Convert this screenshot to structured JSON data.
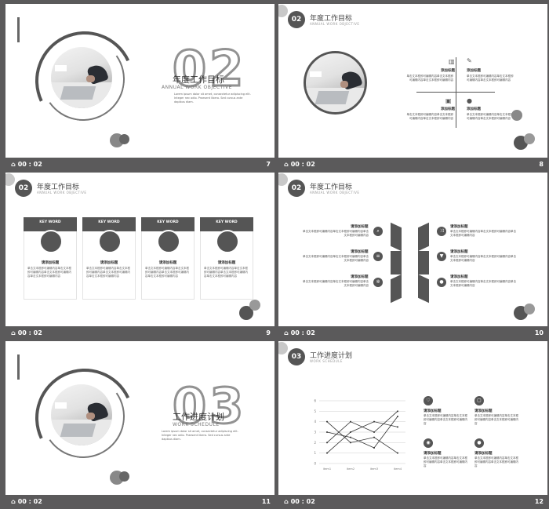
{
  "slides": [
    {
      "footer_time": "00 : 02",
      "page": "7",
      "section_num": "02",
      "title_cn": "年度工作目标",
      "title_en": "ANNUAL WORK OBJECTIVE",
      "desc": "Lorem ipsum dolor sit amet, consectetur adipiscing elit. Integer nec odio. Praesent libero. Sed cursus ante dapibus diam."
    },
    {
      "footer_time": "00 : 02",
      "page": "8",
      "section_num": "02",
      "title_cn": "年度工作目标",
      "title_en": "ANNUAL WORK OBJECTIVE",
      "items": [
        {
          "label": "添加标题",
          "text": "单击文本框即可编辑内容单击文本框即可编辑内容单击文本框即可编辑内容"
        },
        {
          "label": "添加标题",
          "text": "单击文本框即可编辑内容单击文本框即可编辑内容单击文本框即可编辑内容"
        },
        {
          "label": "添加标题",
          "text": "单击文本框即可编辑内容单击文本框即可编辑内容单击文本框即可编辑内容"
        },
        {
          "label": "添加标题",
          "text": "单击文本框即可编辑内容单击文本框即可编辑内容单击文本框即可编辑内容"
        }
      ]
    },
    {
      "footer_time": "00 : 02",
      "page": "9",
      "section_num": "02",
      "title_cn": "年度工作目标",
      "title_en": "ANNUAL WORK OBJECTIVE",
      "cards": [
        {
          "kw": "KEY WORD",
          "label": "请添加标题",
          "text": "单击文本框即可编辑内容单击文本框即可编辑内容单击文本框即可编辑内容单击文本框即可编辑内容"
        },
        {
          "kw": "KEY WORD",
          "label": "请添加标题",
          "text": "单击文本框即可编辑内容单击文本框即可编辑内容单击文本框即可编辑内容单击文本框即可编辑内容"
        },
        {
          "kw": "KEY WORD",
          "label": "请添加标题",
          "text": "单击文本框即可编辑内容单击文本框即可编辑内容单击文本框即可编辑内容单击文本框即可编辑内容"
        },
        {
          "kw": "KEY WORD",
          "label": "请添加标题",
          "text": "单击文本框即可编辑内容单击文本框即可编辑内容单击文本框即可编辑内容单击文本框即可编辑内容"
        }
      ]
    },
    {
      "footer_time": "00 : 02",
      "page": "10",
      "section_num": "02",
      "title_cn": "年度工作目标",
      "title_en": "ANNUAL WORK OBJECTIVE",
      "left_items": [
        {
          "label": "请添加标题",
          "text": "单击文本框即可编辑内容单击文本框即可编辑内容单击文本框即可编辑内容"
        },
        {
          "label": "请添加标题",
          "text": "单击文本框即可编辑内容单击文本框即可编辑内容单击文本框即可编辑内容"
        },
        {
          "label": "请添加标题",
          "text": "单击文本框即可编辑内容单击文本框即可编辑内容单击文本框即可编辑内容"
        }
      ],
      "right_items": [
        {
          "label": "请添加标题",
          "text": "单击文本框即可编辑内容单击文本框即可编辑内容单击文本框即可编辑内容"
        },
        {
          "label": "请添加标题",
          "text": "单击文本框即可编辑内容单击文本框即可编辑内容单击文本框即可编辑内容"
        },
        {
          "label": "请添加标题",
          "text": "单击文本框即可编辑内容单击文本框即可编辑内容单击文本框即可编辑内容"
        }
      ]
    },
    {
      "footer_time": "00 : 02",
      "page": "11",
      "section_num": "03",
      "title_cn": "工作进度计划",
      "title_en": "WORK SCHEDULE",
      "desc": "Lorem ipsum dolor sit amet, consectetur adipiscing elit. Integer nec odio. Praesent libero. Sed cursus ante dapibus diam."
    },
    {
      "footer_time": "00 : 02",
      "page": "12",
      "section_num": "03",
      "title_cn": "工作进度计划",
      "title_en": "WORK SCHEDULE",
      "items": [
        {
          "label": "请添加标题",
          "text": "单击文本框即可编辑内容单击文本框即可编辑内容单击文本框即可编辑内容"
        },
        {
          "label": "请添加标题",
          "text": "单击文本框即可编辑内容单击文本框即可编辑内容单击文本框即可编辑内容"
        },
        {
          "label": "请添加标题",
          "text": "单击文本框即可编辑内容单击文本框即可编辑内容单击文本框即可编辑内容"
        },
        {
          "label": "请添加标题",
          "text": "单击文本框即可编辑内容单击文本框即可编辑内容单击文本框即可编辑内容"
        }
      ]
    }
  ],
  "chart_data": {
    "type": "line",
    "categories": [
      "item1",
      "item2",
      "item3",
      "item4"
    ],
    "series": [
      {
        "values": [
          2,
          4,
          3,
          5
        ]
      },
      {
        "values": [
          4,
          2,
          2.5,
          1
        ]
      },
      {
        "values": [
          1,
          3,
          4,
          3.5
        ]
      },
      {
        "values": [
          3,
          2.5,
          1.5,
          4.5
        ]
      }
    ],
    "ylim": [
      0,
      6
    ],
    "yticks": [
      0,
      1,
      2,
      3,
      4,
      5,
      6
    ],
    "colors": {
      "line": "#333333",
      "grid": "#cccccc"
    }
  },
  "colors": {
    "bg": "#5b5a5b",
    "dark": "#555555",
    "light": "#c8c8c8"
  }
}
